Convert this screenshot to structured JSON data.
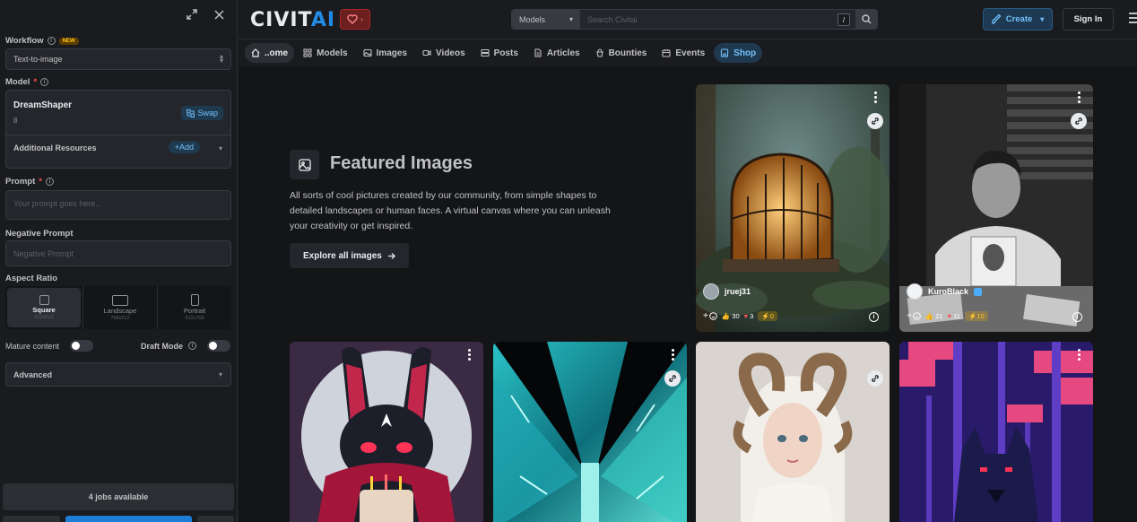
{
  "panel": {
    "workflow_label": "Workflow",
    "workflow_badge": "NEW",
    "workflow_value": "Text-to-image",
    "model_label": "Model",
    "model_name": "DreamShaper",
    "model_version": "8",
    "swap_label": "Swap",
    "additional_resources_label": "Additional Resources",
    "add_label": "+Add",
    "prompt_label": "Prompt",
    "prompt_placeholder": "Your prompt goes here...",
    "negative_prompt_label": "Negative Prompt",
    "negative_prompt_placeholder": "Negative Prompt",
    "aspect_ratio_label": "Aspect Ratio",
    "aspect_options": [
      {
        "name": "Square",
        "size": "512x512",
        "active": true
      },
      {
        "name": "Landscape",
        "size": "768x512",
        "active": false
      },
      {
        "name": "Portrait",
        "size": "512x768",
        "active": false
      }
    ],
    "mature_content_label": "Mature content",
    "draft_mode_label": "Draft Mode",
    "advanced_label": "Advanced",
    "jobs_available": "4 jobs available"
  },
  "header": {
    "logo_part1": "CIVIT",
    "logo_part2": "AI",
    "search_category": "Models",
    "search_placeholder": "Search Civitai",
    "search_shortcut": "/",
    "create_label": "Create",
    "signin_label": "Sign In"
  },
  "nav": {
    "items": [
      {
        "label": "..ome",
        "icon": "home-icon"
      },
      {
        "label": "Models",
        "icon": "models-icon"
      },
      {
        "label": "Images",
        "icon": "images-icon"
      },
      {
        "label": "Videos",
        "icon": "videos-icon"
      },
      {
        "label": "Posts",
        "icon": "posts-icon"
      },
      {
        "label": "Articles",
        "icon": "articles-icon"
      },
      {
        "label": "Bounties",
        "icon": "bounties-icon"
      },
      {
        "label": "Events",
        "icon": "events-icon"
      },
      {
        "label": "Shop",
        "icon": "shop-icon"
      }
    ]
  },
  "featured": {
    "title": "Featured Images",
    "description": "All sorts of cool pictures created by our community, from simple shapes to detailed landscapes or human faces. A virtual canvas where you can unleash your creativity or get inspired.",
    "explore_label": "Explore all images"
  },
  "cards": [
    {
      "author": "jruej31",
      "likes": "30",
      "hearts": "3",
      "buzz": "0"
    },
    {
      "author": "KuroBlack",
      "likes": "21",
      "hearts": "11",
      "buzz": "10"
    }
  ],
  "colors": {
    "accent": "#228be6",
    "accent_light": "#74c0fc",
    "background": "#141517",
    "surface": "#25262b"
  }
}
